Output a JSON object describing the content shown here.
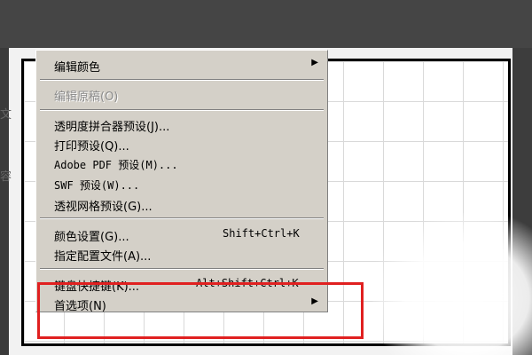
{
  "background": {
    "stray_text_1": "文",
    "stray_text_2": "容"
  },
  "menu": {
    "items": [
      {
        "label": "编辑颜色",
        "shortcut": "",
        "submenu": true,
        "enabled": true
      },
      {
        "label": "编辑原稿(O)",
        "shortcut": "",
        "submenu": false,
        "enabled": false
      },
      {
        "label": "透明度拼合器预设(J)...",
        "shortcut": "",
        "submenu": false,
        "enabled": true
      },
      {
        "label": "打印预设(Q)...",
        "shortcut": "",
        "submenu": false,
        "enabled": true
      },
      {
        "label": "Adobe PDF 预设(M)...",
        "shortcut": "",
        "submenu": false,
        "enabled": true
      },
      {
        "label": "SWF 预设(W)...",
        "shortcut": "",
        "submenu": false,
        "enabled": true
      },
      {
        "label": "透视网格预设(G)...",
        "shortcut": "",
        "submenu": false,
        "enabled": true
      },
      {
        "label": "颜色设置(G)...",
        "shortcut": "Shift+Ctrl+K",
        "submenu": false,
        "enabled": true
      },
      {
        "label": "指定配置文件(A)...",
        "shortcut": "",
        "submenu": false,
        "enabled": true
      },
      {
        "label": "键盘快捷键(K)...",
        "shortcut": "Alt+Shift+Ctrl+K",
        "submenu": false,
        "enabled": true
      },
      {
        "label": "首选项(N)",
        "shortcut": "",
        "submenu": true,
        "enabled": true
      }
    ],
    "submenu_arrow": "▶"
  },
  "annotation": {
    "color": "#e02020"
  }
}
